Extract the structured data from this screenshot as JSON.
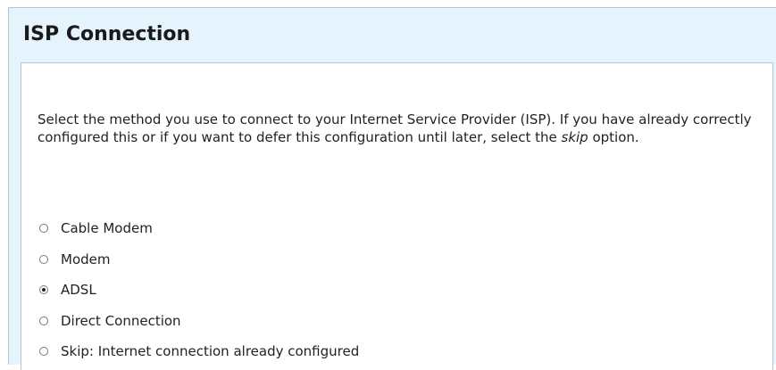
{
  "header": {
    "title": "ISP Connection"
  },
  "intro": {
    "text_before": "Select the method you use to connect to your Internet Service Provider (ISP). If you have already correctly configured this or if you want to defer this configuration until later, select the ",
    "emphasis": "skip",
    "text_after": " option."
  },
  "options": [
    {
      "label": "Cable Modem",
      "checked": false
    },
    {
      "label": "Modem",
      "checked": false
    },
    {
      "label": "ADSL",
      "checked": true
    },
    {
      "label": "Direct Connection",
      "checked": false
    },
    {
      "label": "Skip: Internet connection already configured",
      "checked": false
    }
  ],
  "colors": {
    "panel_background": "#e4f3fc",
    "panel_border": "#a6cbe4",
    "content_background": "#ffffff"
  }
}
